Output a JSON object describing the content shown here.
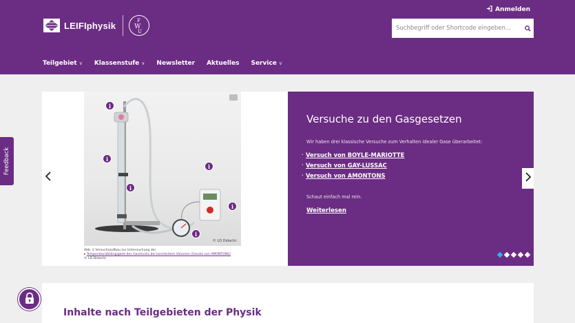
{
  "header": {
    "login_label": "Anmelden",
    "logo_text": "LEIFIphysik",
    "partner_logo": "FWU",
    "search_placeholder": "Suchbegriff oder Shortcode eingeben..."
  },
  "nav": {
    "items": [
      {
        "label": "Teilgebiet",
        "dropdown": true
      },
      {
        "label": "Klassenstufe",
        "dropdown": true
      },
      {
        "label": "Newsletter",
        "dropdown": false
      },
      {
        "label": "Aktuelles",
        "dropdown": false
      },
      {
        "label": "Service",
        "dropdown": true
      }
    ]
  },
  "feedback_label": "Feedback",
  "slider": {
    "photo_credit": "© LD Didactic",
    "caption_line1": "Abb. 2 Versuchsaufbau zur Untersuchung der",
    "caption_link": "Temperaturabhängigkeit des Gasdrucks bei konstantem Volumen (Gesetz von AMONTONS)",
    "caption_line3": "© LD Didactic",
    "info_marker": "i",
    "title": "Versuche zu den Gasgesetzen",
    "intro": "Wir haben drei klassische Versuche zum Verhalten idealer Gase überarbeitet:",
    "links": [
      "Versuch von BOYLE-MARIOTTE",
      "Versuch von GAY-LUSSAC",
      "Versuch von AMONTONS"
    ],
    "outro": "Schaut einfach mal rein.",
    "read_more": "Weiterlesen",
    "slide_count": 5,
    "active_slide": 1
  },
  "content_section": {
    "title": "Inhalte nach Teilgebieten der Physik"
  },
  "colors": {
    "brand_purple": "#6b2c83",
    "active_dot": "#2bb7e6",
    "page_bg": "#efefef"
  }
}
